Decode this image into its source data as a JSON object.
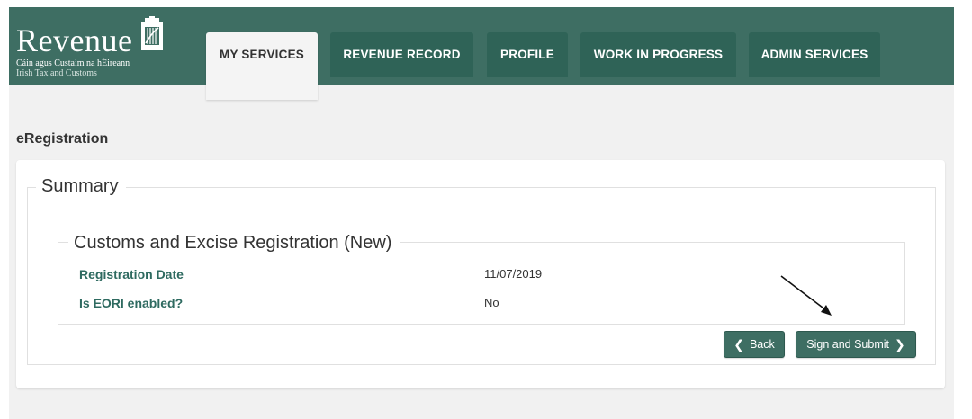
{
  "brand": {
    "name": "Revenue",
    "subtitle_irish": "Cáin agus Custaim na hÉireann",
    "subtitle_english": "Irish Tax and Customs",
    "logo_icon": "harp-icon"
  },
  "nav": {
    "tabs": [
      {
        "label": "MY SERVICES",
        "active": true
      },
      {
        "label": "REVENUE RECORD",
        "active": false
      },
      {
        "label": "PROFILE",
        "active": false
      },
      {
        "label": "WORK IN PROGRESS",
        "active": false
      },
      {
        "label": "ADMIN SERVICES",
        "active": false
      }
    ]
  },
  "page": {
    "title": "eRegistration"
  },
  "summary": {
    "legend": "Summary",
    "section": {
      "legend": "Customs and Excise Registration (New)",
      "rows": [
        {
          "label": "Registration Date",
          "value": "11/07/2019"
        },
        {
          "label": "Is EORI enabled?",
          "value": "No"
        }
      ]
    }
  },
  "actions": {
    "back_label": "Back",
    "back_icon": "chevron-left-icon",
    "submit_label": "Sign and Submit",
    "submit_icon": "chevron-right-icon"
  },
  "colors": {
    "header": "#3e6e63",
    "tab": "#2f6357",
    "label_text": "#2e6a60"
  }
}
